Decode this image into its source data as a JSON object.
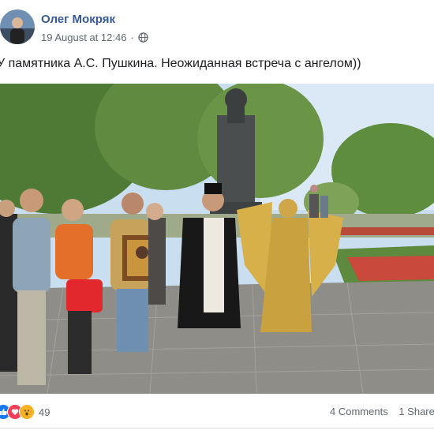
{
  "post": {
    "author": "Олег Мокряк",
    "timestamp": "19 August at 12:46",
    "separator": "·",
    "privacy_icon": "globe-icon",
    "caption": "У памятника А.С. Пушкина. Неожиданная встреча с ангелом))"
  },
  "photo": {
    "semantic": "group-photo-near-pushkin-monument-with-priest-and-golden-angel"
  },
  "footer": {
    "reactions": [
      {
        "name": "like-reaction-icon",
        "color": "#1877f2"
      },
      {
        "name": "love-reaction-icon",
        "color": "#f33e58"
      },
      {
        "name": "wow-reaction-icon",
        "color": "#f7b125"
      }
    ],
    "reaction_count": "49",
    "comments": "4 Comments",
    "shares": "1 Share"
  },
  "colors": {
    "author_link": "#385898",
    "meta_text": "#606770",
    "body_text": "#1c1e21"
  }
}
